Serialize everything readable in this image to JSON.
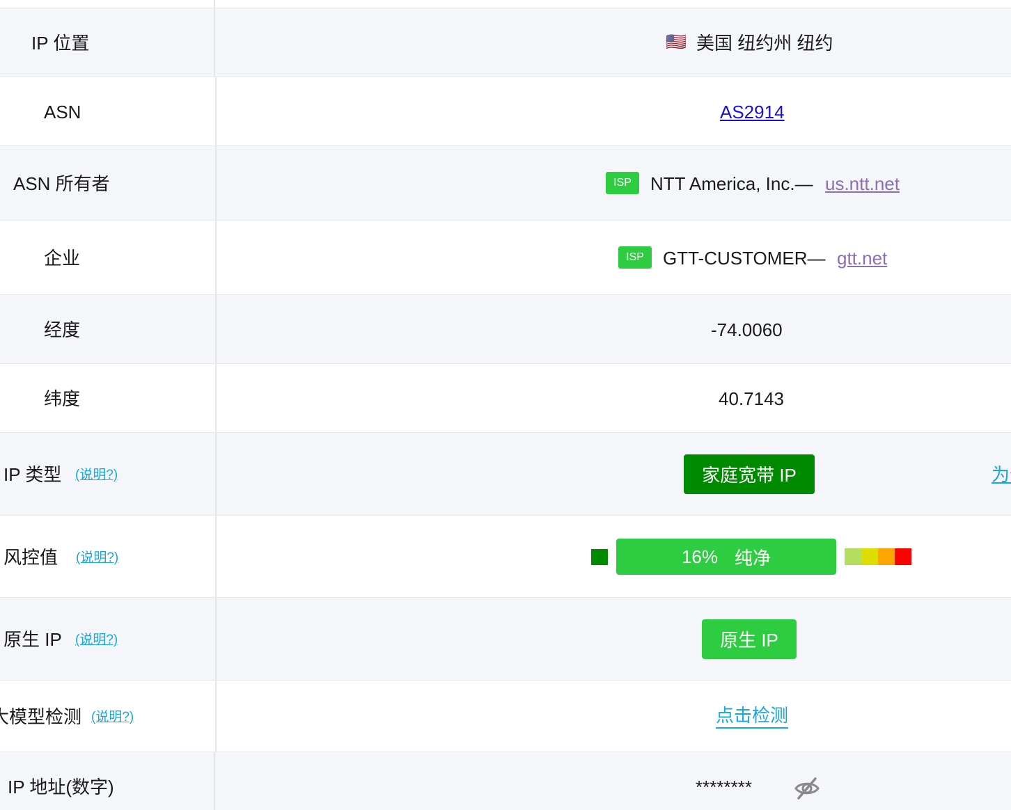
{
  "rows": {
    "location": {
      "label": "IP 位置",
      "flag": "🇺🇸",
      "value": "美国 纽约州 纽约"
    },
    "asn": {
      "label": "ASN",
      "value": "AS2914"
    },
    "asn_owner": {
      "label": "ASN 所有者",
      "badge": "ISP",
      "value": "NTT America, Inc.—",
      "link": "us.ntt.net"
    },
    "company": {
      "label": "企业",
      "badge": "ISP",
      "value": "GTT-CUSTOMER—",
      "link": "gtt.net"
    },
    "longitude": {
      "label": "经度",
      "value": "-74.0060"
    },
    "latitude": {
      "label": "纬度",
      "value": "40.7143"
    },
    "ip_type": {
      "label": "IP 类型",
      "note": "(说明?)",
      "value": "家庭宽带 IP",
      "side_link": "为何"
    },
    "risk": {
      "label": "风控值",
      "note": "(说明?)",
      "value": "16%",
      "status": "纯净",
      "level_percent": 16
    },
    "native": {
      "label": "原生 IP",
      "note": "(说明?)",
      "value": "原生 IP"
    },
    "llm": {
      "label": "大模型检测",
      "note": "(说明?)",
      "value": "点击检测"
    },
    "ip_numeric": {
      "label": "IP 地址(数字)",
      "value": "********"
    }
  },
  "colors": {
    "dark_green": "#008a00",
    "green": "#2ecc40",
    "risk_scale": [
      "#b5de5f",
      "#dede00",
      "#ffa500",
      "#ff0000"
    ],
    "link_blue": "#1a10d8",
    "note_blue": "#19a7e0",
    "visited": "#8b6fb5"
  },
  "icons": {
    "eye_toggle": "eye-slash-icon"
  }
}
